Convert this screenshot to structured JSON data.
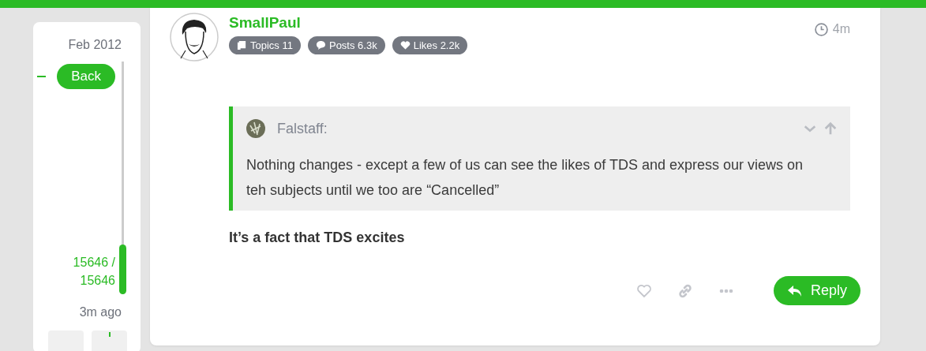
{
  "timeline": {
    "start_date": "Feb 2012",
    "back_label": "Back",
    "position": "15646 / 15646",
    "age": "3m ago"
  },
  "post": {
    "username": "SmallPaul",
    "time": "4m",
    "stats": [
      {
        "kind": "topics",
        "label": "Topics 11"
      },
      {
        "kind": "posts",
        "label": "Posts 6.3k"
      },
      {
        "kind": "likes",
        "label": "Likes 2.2k"
      }
    ],
    "quote": {
      "author": "Falstaff:",
      "text": "Nothing changes - except a few of us can see the likes of TDS and express our views on teh subjects until we too are “Cancelled”"
    },
    "body": "It’s a fact that TDS excites",
    "reply_label": "Reply"
  }
}
